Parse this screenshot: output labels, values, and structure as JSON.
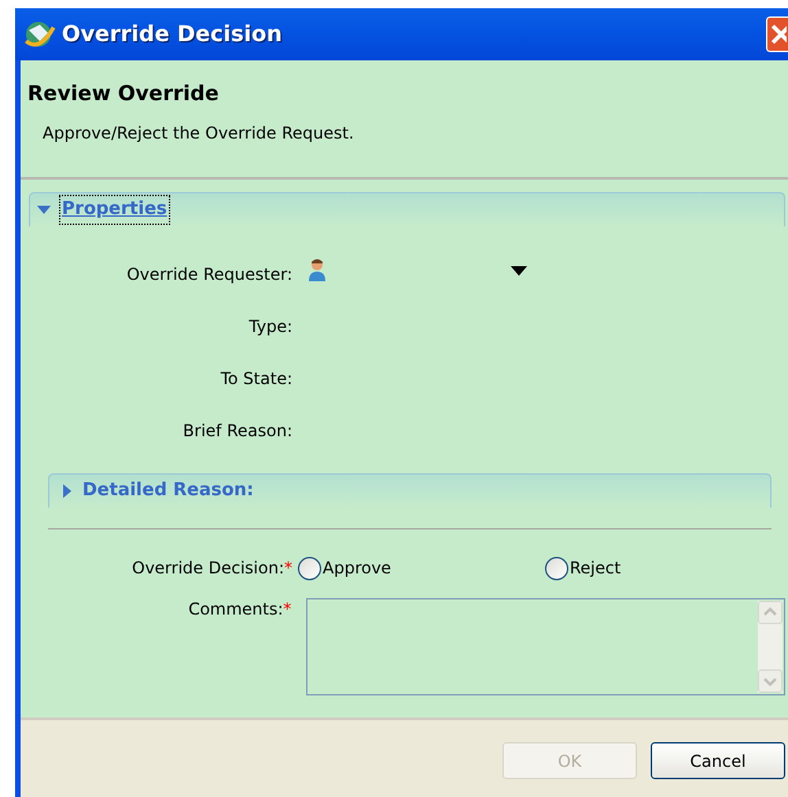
{
  "window": {
    "title": "Override Decision"
  },
  "header": {
    "title": "Review Override",
    "description": "Approve/Reject the Override Request."
  },
  "properties": {
    "label": "Properties",
    "expanded": true,
    "fields": [
      {
        "label": "Override Requester:",
        "kind": "person-dropdown"
      },
      {
        "label": "Type:",
        "kind": "plain"
      },
      {
        "label": "To State:",
        "kind": "plain"
      },
      {
        "label": "Brief Reason:",
        "kind": "plain"
      }
    ],
    "detailed_reason": {
      "label": "Detailed Reason:",
      "expanded": false
    }
  },
  "decision": {
    "label": "Override Decision:",
    "required_mark": "*",
    "options": [
      {
        "label": "Approve",
        "selected": false
      },
      {
        "label": "Reject",
        "selected": false
      }
    ]
  },
  "comments": {
    "label": "Comments:",
    "required_mark": "*"
  },
  "buttons": [
    {
      "label": "OK",
      "disabled": true
    },
    {
      "label": "Cancel",
      "disabled": false
    }
  ]
}
